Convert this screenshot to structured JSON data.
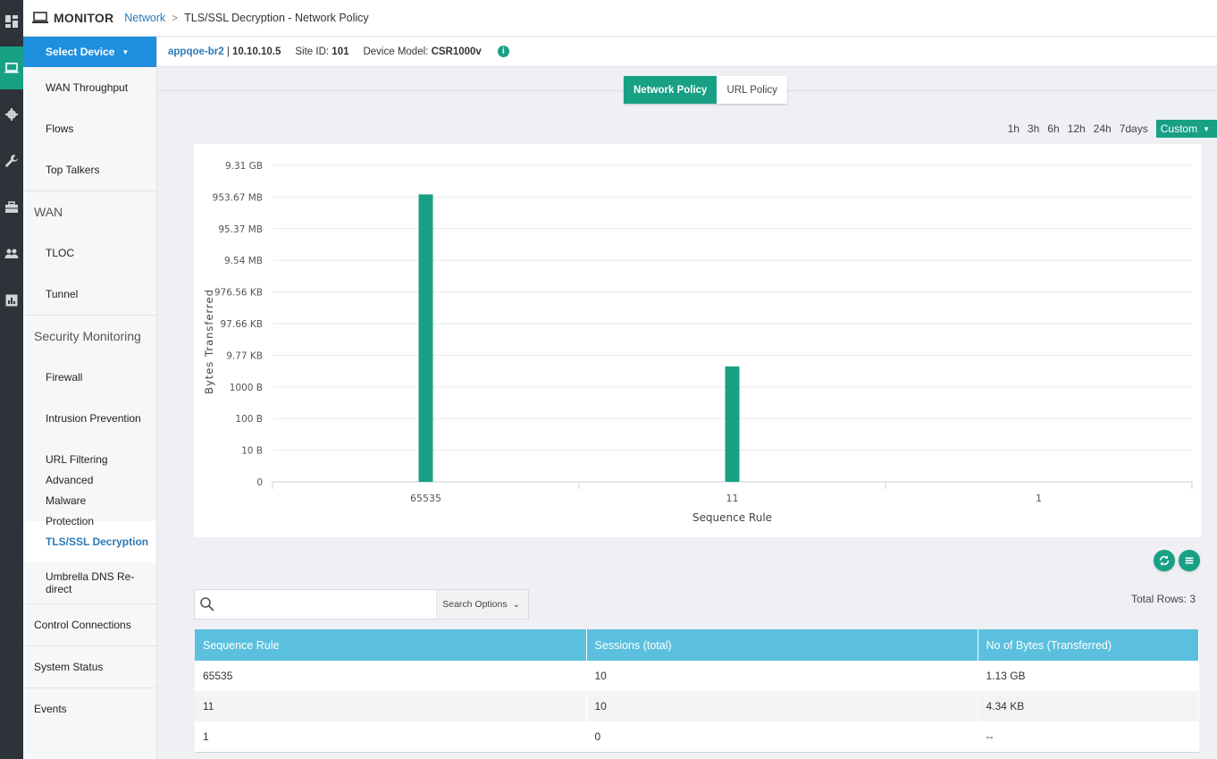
{
  "header": {
    "app_title": "MONITOR",
    "breadcrumb_link": "Network",
    "breadcrumb_sep": ">",
    "breadcrumb_current": "TLS/SSL Decryption - Network Policy"
  },
  "rail": {
    "icons": [
      "dashboard-icon",
      "monitor-icon",
      "gear-icon",
      "wrench-icon",
      "toolbox-icon",
      "users-icon",
      "analytics-icon"
    ],
    "active": "monitor-icon"
  },
  "sidenav": {
    "select_device": "Select Device",
    "items": [
      {
        "label": "WAN Throughput"
      },
      {
        "label": "Flows"
      },
      {
        "label": "Top Talkers"
      }
    ],
    "wan_section": "WAN",
    "wan_items": [
      {
        "label": "TLOC"
      },
      {
        "label": "Tunnel"
      }
    ],
    "security_section": "Security Monitoring",
    "security_items": [
      {
        "label": "Firewall"
      },
      {
        "label": "Intrusion Prevention"
      },
      {
        "label": "URL Filtering"
      },
      {
        "label": "Advanced Malware Protection"
      },
      {
        "label": "TLS/SSL Decryption"
      },
      {
        "label": "Umbrella DNS Re-direct"
      }
    ],
    "bottom_items": [
      {
        "label": "Control Connections"
      },
      {
        "label": "System Status"
      },
      {
        "label": "Events"
      }
    ]
  },
  "device_bar": {
    "device_name": "appqoe-br2",
    "separator": " | ",
    "ip": "10.10.10.5",
    "site_label": "Site ID:",
    "site_value": "101",
    "model_label": "Device Model:",
    "model_value": "CSR1000v",
    "info_icon": "i"
  },
  "tabs": [
    {
      "label": "Network Policy",
      "active": true
    },
    {
      "label": "URL Policy",
      "active": false
    }
  ],
  "time_range": {
    "options": [
      "1h",
      "3h",
      "6h",
      "12h",
      "24h",
      "7days"
    ],
    "selected": "Custom"
  },
  "chart_data": {
    "type": "bar",
    "categories": [
      "65535",
      "11",
      "1"
    ],
    "values_bytes": [
      1213328261,
      4444,
      0
    ],
    "y_scale": "log",
    "y_tick_labels": [
      "0",
      "10 B",
      "100 B",
      "1000 B",
      "9.77 KB",
      "97.66 KB",
      "976.56 KB",
      "9.54 MB",
      "95.37 MB",
      "953.67 MB",
      "9.31 GB"
    ],
    "y_tick_values": [
      1,
      10,
      100,
      1000,
      10000,
      100000,
      1000000,
      10000000,
      100000000,
      1000000000,
      10000000000
    ],
    "xlabel": "Sequence Rule",
    "ylabel": "Bytes Transferred",
    "bar_color": "#18a085",
    "grid": true
  },
  "search": {
    "placeholder": "",
    "options_label": "Search Options",
    "total_rows": "Total Rows: 3"
  },
  "table": {
    "columns": [
      "Sequence Rule",
      "Sessions (total)",
      "No of Bytes (Transferred)"
    ],
    "rows": [
      [
        "65535",
        "10",
        "1.13 GB"
      ],
      [
        "11",
        "10",
        "4.34 KB"
      ],
      [
        "1",
        "0",
        "--"
      ]
    ]
  },
  "colors": {
    "accent": "#18a085",
    "brand_blue": "#1e8ede",
    "table_header": "#5bc0de",
    "rail_bg": "#2d3338"
  }
}
